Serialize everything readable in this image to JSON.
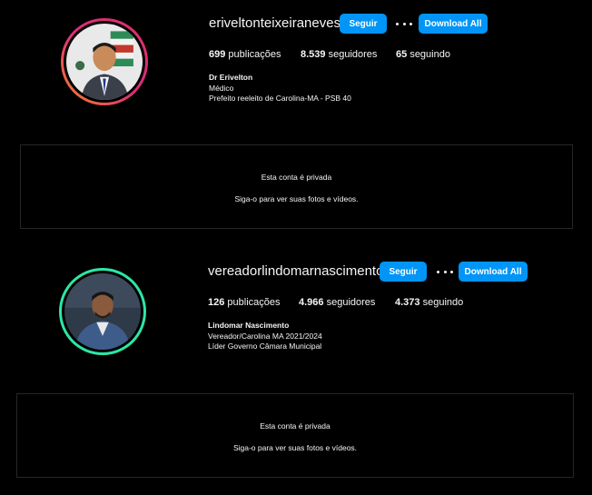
{
  "profiles": [
    {
      "username": "eriveltonteixeiraneves",
      "follow_label": "Seguir",
      "download_label": "Download All",
      "more_icon": "more-horizontal-icon",
      "posts_count": "699",
      "posts_label": "publicações",
      "followers_count": "8.539",
      "followers_label": "seguidores",
      "following_count": "65",
      "following_label": "seguindo",
      "bio_name": "Dr Erivelton",
      "bio_lines": [
        "Médico",
        "Prefeito reeleito de Carolina-MA - PSB 40"
      ],
      "ring_color": "#e1306c",
      "private_title": "Esta conta é privada",
      "private_subtitle": "Siga-o para ver suas fotos e vídeos."
    },
    {
      "username": "vereadorlindomarnascimento",
      "follow_label": "Seguir",
      "download_label": "Download All",
      "more_icon": "more-horizontal-icon",
      "posts_count": "126",
      "posts_label": "publicações",
      "followers_count": "4.966",
      "followers_label": "seguidores",
      "following_count": "4.373",
      "following_label": "seguindo",
      "bio_name": "Lindomar Nascimento",
      "bio_lines": [
        "Vereador/Carolina MA 2021/2024",
        "Líder Governo Câmara Municipal"
      ],
      "ring_color": "#2ee6a6",
      "private_title": "Esta conta é privada",
      "private_subtitle": "Siga-o para ver suas fotos e vídeos."
    }
  ],
  "colors": {
    "background": "#000000",
    "button_blue": "#0095f6",
    "border": "#262626"
  }
}
